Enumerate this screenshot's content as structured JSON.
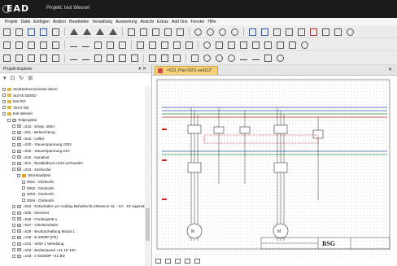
{
  "app": {
    "logo_text": "EAD",
    "window_title": "Projekt: test Wessel"
  },
  "menu": [
    "Projekt",
    "Datei",
    "Einfügen",
    "Ändern",
    "Bearbeiten",
    "Verwaltung",
    "Auswertung",
    "Ansicht",
    "Extras",
    "Add Ons",
    "Fenster",
    "Hilfe"
  ],
  "left_panel": {
    "title": "Projekt-Explorer",
    "controls": "▾ ✕",
    "tree": [
      {
        "label": "Strukturkennzeichen demo",
        "depth": 0,
        "icon": "folder"
      },
      {
        "label": "SUITE DEMO",
        "depth": 0,
        "icon": "folder"
      },
      {
        "label": "test RO",
        "depth": 0,
        "icon": "folder"
      },
      {
        "label": "TEST RB",
        "depth": 0,
        "icon": "folder"
      },
      {
        "label": "test Wessel",
        "depth": 0,
        "icon": "folder"
      },
      {
        "label": "Teilprojekte",
        "depth": 1,
        "icon": "subfolder"
      },
      {
        "label": "=010 - Einsp. 400A",
        "depth": 2,
        "icon": "subfolder"
      },
      {
        "label": "=011 - Beleuchtung",
        "depth": 2,
        "icon": "subfolder"
      },
      {
        "label": "=012 - Lüfter",
        "depth": 2,
        "icon": "subfolder"
      },
      {
        "label": "=020 - Steuerspannung 230V",
        "depth": 2,
        "icon": "subfolder"
      },
      {
        "label": "=030 - Steuerspannung 24V",
        "depth": 2,
        "icon": "subfolder"
      },
      {
        "label": "=040 - Kanalnet",
        "depth": 2,
        "icon": "subfolder"
      },
      {
        "label": "=041 - Breitbelbuch nicht vorhanden",
        "depth": 2,
        "icon": "subfolder"
      },
      {
        "label": "=023 - Dreheofer",
        "depth": 2,
        "icon": "subfolder"
      },
      {
        "label": "Stromlaufplan",
        "depth": 3,
        "icon": "folder-open"
      },
      {
        "label": "0001 - Dreheofn",
        "depth": 4,
        "icon": "none"
      },
      {
        "label": "0002 - Dreheofn",
        "depth": 4,
        "icon": "none"
      },
      {
        "label": "0003 - Dreheofn",
        "depth": 4,
        "icon": "none"
      },
      {
        "label": "0004 - Dreheofn",
        "depth": 4,
        "icon": "none"
      },
      {
        "label": "=024 - Entschalter um Ausbay Befesltechn (Reserve XL - XA - ST eigenst)",
        "depth": 2,
        "icon": "subfolder"
      },
      {
        "label": "=025 - Dreverer",
        "depth": 2,
        "icon": "subfolder"
      },
      {
        "label": "=026 - Fördergerät 1",
        "depth": 2,
        "icon": "subfolder"
      },
      {
        "label": "=027 - Arbeitsmittaler",
        "depth": 2,
        "icon": "subfolder"
      },
      {
        "label": "=028 - Bruttoschaltung Modul 1",
        "depth": 2,
        "icon": "subfolder"
      },
      {
        "label": "=100 - E-2000P (PR)",
        "depth": 2,
        "icon": "subfolder"
      },
      {
        "label": "=101 - Seite 1 Verteilung",
        "depth": 2,
        "icon": "subfolder"
      },
      {
        "label": "=102 - Bedienpanel +41 1P 100",
        "depth": 2,
        "icon": "subfolder"
      },
      {
        "label": "=103 - 1-D2000P +41 BD",
        "depth": 2,
        "icon": "subfolder"
      }
    ]
  },
  "editor": {
    "tab_label": "=023_Plan:0001.sed112*",
    "tab_close": "✕",
    "title_block_logo": "BSG"
  },
  "colors": {
    "title_bg": "#1b1b1b",
    "tab_bg": "#f7d27a",
    "wire_blue": "#2a56a8",
    "wire_green": "#2f9a3a",
    "wire_red": "#c22"
  }
}
